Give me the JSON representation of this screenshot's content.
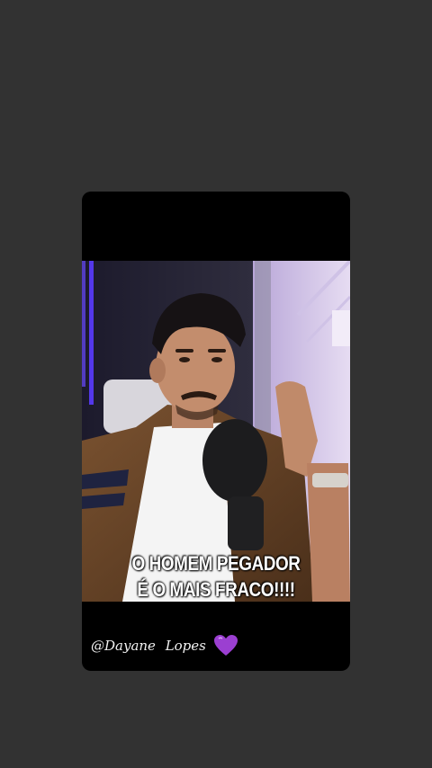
{
  "story": {
    "caption_lines": [
      "O HOMEM PEGADOR",
      "É O MAIS FRACO!!!!"
    ],
    "credit": "@Dayane  Lopes",
    "credit_icon": "purple-heart-icon"
  },
  "colors": {
    "page_background": "#323232",
    "card_background": "#000000",
    "heart": "#9b3fd1"
  }
}
